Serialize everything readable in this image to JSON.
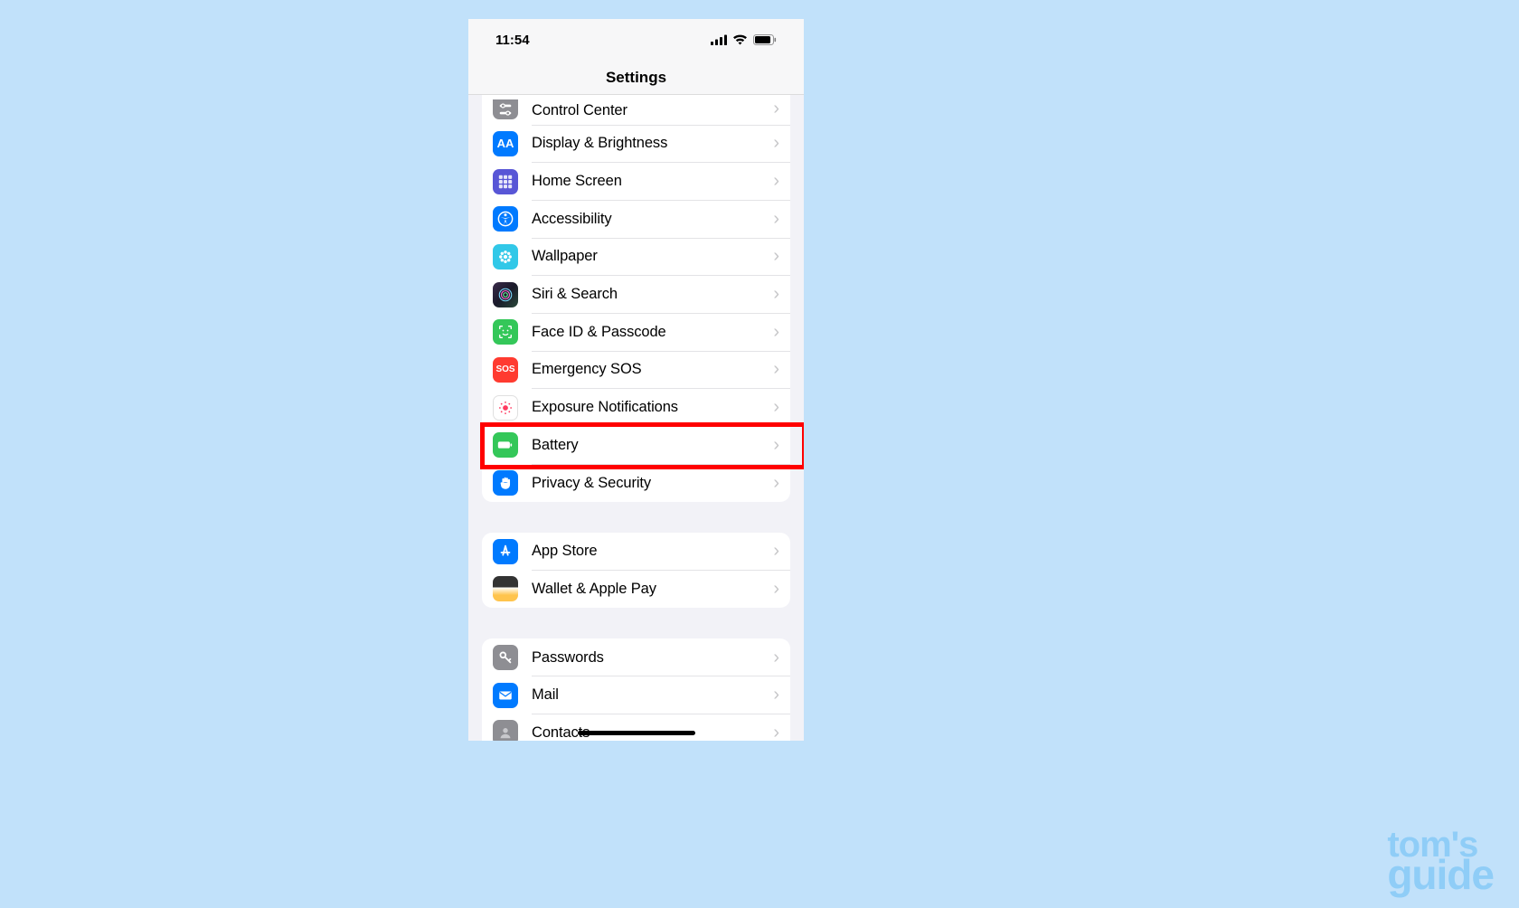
{
  "status": {
    "time": "11:54"
  },
  "nav": {
    "title": "Settings"
  },
  "groups": [
    {
      "rows": [
        {
          "key": "control-center",
          "label": "Control Center",
          "icon": "sliders",
          "bg": "bg-gray"
        },
        {
          "key": "display-brightness",
          "label": "Display & Brightness",
          "icon": "aa",
          "bg": "bg-blue"
        },
        {
          "key": "home-screen",
          "label": "Home Screen",
          "icon": "grid",
          "bg": "bg-purple"
        },
        {
          "key": "accessibility",
          "label": "Accessibility",
          "icon": "accessibility",
          "bg": "bg-blue"
        },
        {
          "key": "wallpaper",
          "label": "Wallpaper",
          "icon": "flower",
          "bg": "bg-cyan"
        },
        {
          "key": "siri-search",
          "label": "Siri & Search",
          "icon": "siri",
          "bg": "bg-black"
        },
        {
          "key": "face-id-passcode",
          "label": "Face ID & Passcode",
          "icon": "face",
          "bg": "bg-green"
        },
        {
          "key": "emergency-sos",
          "label": "Emergency SOS",
          "icon": "sos",
          "bg": "bg-red"
        },
        {
          "key": "exposure-notifications",
          "label": "Exposure Notifications",
          "icon": "exposure",
          "bg": "bg-white"
        },
        {
          "key": "battery",
          "label": "Battery",
          "icon": "battery",
          "bg": "bg-green",
          "highlighted": true
        },
        {
          "key": "privacy-security",
          "label": "Privacy & Security",
          "icon": "hand",
          "bg": "bg-blue"
        }
      ]
    },
    {
      "rows": [
        {
          "key": "app-store",
          "label": "App Store",
          "icon": "appstore",
          "bg": "bg-blue"
        },
        {
          "key": "wallet-apple-pay",
          "label": "Wallet & Apple Pay",
          "icon": "wallet",
          "bg": "bg-walgrad"
        }
      ]
    },
    {
      "rows": [
        {
          "key": "passwords",
          "label": "Passwords",
          "icon": "key",
          "bg": "bg-gray"
        },
        {
          "key": "mail",
          "label": "Mail",
          "icon": "mail",
          "bg": "bg-bluewhite"
        },
        {
          "key": "contacts",
          "label": "Contacts",
          "icon": "contacts",
          "bg": "bg-gray"
        }
      ]
    }
  ],
  "watermark": {
    "line1": "tom's",
    "line2": "guide"
  }
}
